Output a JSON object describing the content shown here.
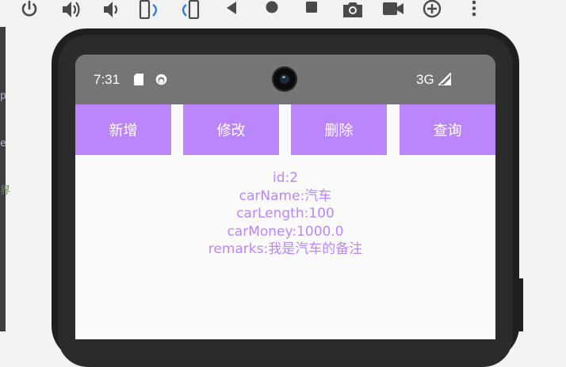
{
  "toolbar": {
    "icons": [
      "power-icon",
      "volume-up-icon",
      "volume-down-icon",
      "rotate-left-icon",
      "rotate-right-icon",
      "back-icon",
      "home-icon",
      "overview-icon",
      "camera-icon",
      "video-icon",
      "zoom-icon",
      "more-icon"
    ]
  },
  "ide_strip": {
    "chars": [
      "p",
      "e",
      "界"
    ]
  },
  "status_bar": {
    "time": "7:31",
    "network": "3G",
    "icons": [
      "sd-card-icon",
      "app-notification-icon",
      "signal-icon"
    ]
  },
  "actions": {
    "add": "新增",
    "edit": "修改",
    "delete": "删除",
    "query": "查询"
  },
  "record": {
    "id": "id:2",
    "car_name": "carName:汽车",
    "car_length": "carLength:100",
    "car_money": "carMoney:1000.0",
    "remarks": "remarks:我是汽车的备注"
  },
  "colors": {
    "accent": "#bb86fc",
    "status_bar": "#757575",
    "screen_bg": "#fafafa",
    "phone_frame": "#1f1f1f"
  }
}
